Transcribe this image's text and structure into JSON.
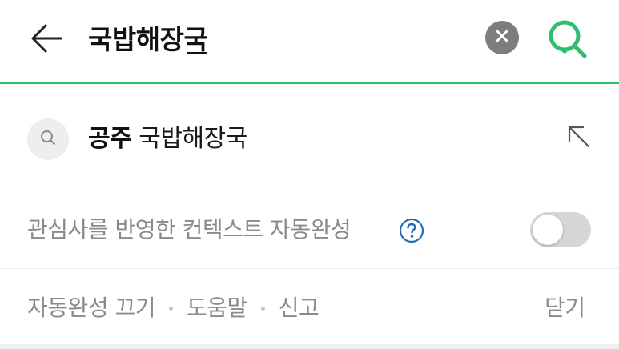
{
  "search": {
    "query": "국밥해장국"
  },
  "suggestions": [
    {
      "highlight": "공주",
      "rest": " 국밥해장국"
    }
  ],
  "context": {
    "label": "관심사를 반영한 컨텍스트 자동완성",
    "toggle_on": false
  },
  "footer": {
    "links": [
      "자동완성 끄기",
      "도움말",
      "신고"
    ],
    "close_label": "닫기"
  },
  "icons": {
    "back": "arrow-left-icon",
    "clear": "close-circle-icon",
    "search": "search-icon",
    "suggest": "search-icon",
    "fill": "arrow-up-left-icon",
    "help": "question-circle-icon"
  },
  "colors": {
    "accent": "#2fbf71",
    "help": "#1e6fb8",
    "muted_text": "#8a8a8a",
    "toggle_off": "#d6d6d6"
  }
}
